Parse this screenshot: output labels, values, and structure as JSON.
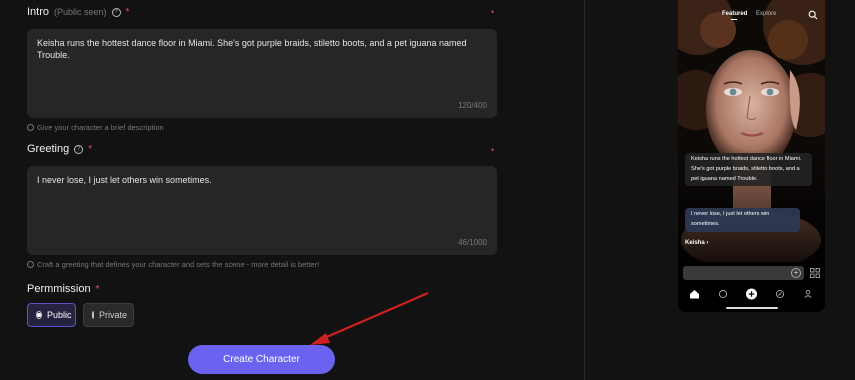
{
  "intro": {
    "label": "Intro",
    "hint": "(Public seen)",
    "help_icon": "?",
    "required_mark": "*",
    "value": "Keisha runs the hottest dance floor in Miami. She's got purple braids, stiletto boots, and a pet iguana named Trouble.",
    "counter": "120/400",
    "help_text": "Give your character a brief description"
  },
  "greeting": {
    "label": "Greeting",
    "help_icon": "?",
    "required_mark": "*",
    "value": "I never lose, I just let others win sometimes.",
    "counter": "46/1000",
    "help_text": "Craft a greeting that defines your character and sets the scene - more detail is better!"
  },
  "permission": {
    "label": "Permmission",
    "required_mark": "*",
    "options": [
      "Public",
      "Private"
    ],
    "selected": "Public"
  },
  "create_button": "Create Character",
  "required_dot": "•",
  "preview": {
    "tabs": [
      "Featured",
      "Explore"
    ],
    "active_tab": "Featured",
    "intro_text": "Keisha runs the hottest dance floor in Miami. She's got purple braids, stiletto boots, and a pet iguana named Trouble.",
    "greeting_text": "I never lose, I just let others win sometimes.",
    "name": "Keisha ›",
    "nav_icons": [
      "home-icon",
      "chat-icon",
      "plus-icon",
      "compass-icon",
      "profile-icon"
    ]
  },
  "colors": {
    "accent": "#6b63f0",
    "required": "#e05555",
    "arrow": "#d02020"
  }
}
